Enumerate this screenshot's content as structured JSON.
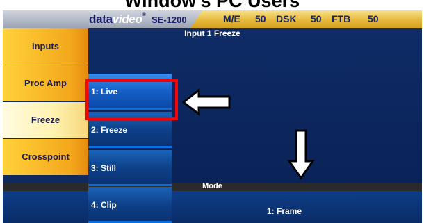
{
  "document_title": "Window's PC Users",
  "topbar": {
    "brand_prefix": "data",
    "brand_suffix": "video",
    "model": "SE-1200",
    "status": [
      {
        "label": "M/E"
      },
      {
        "label": "50"
      },
      {
        "label": "DSK"
      },
      {
        "label": "50"
      },
      {
        "label": "FTB"
      },
      {
        "label": "50"
      }
    ]
  },
  "sidebar": {
    "items": [
      {
        "label": "Inputs"
      },
      {
        "label": "Proc Amp"
      },
      {
        "label": "Freeze",
        "active": true
      },
      {
        "label": "Crosspoint"
      }
    ]
  },
  "panel": {
    "title": "Input 1 Freeze"
  },
  "dropdown": {
    "options": [
      {
        "label": "1: Live",
        "selected": true
      },
      {
        "label": "2: Freeze"
      },
      {
        "label": "3: Still"
      },
      {
        "label": "4: Clip"
      }
    ]
  },
  "mode": {
    "label": "Mode",
    "value": "1: Frame"
  },
  "colors": {
    "accent_yellow": "#f4a71c",
    "panel_blue": "#0f2c66",
    "highlight_red": "#ff0000"
  }
}
